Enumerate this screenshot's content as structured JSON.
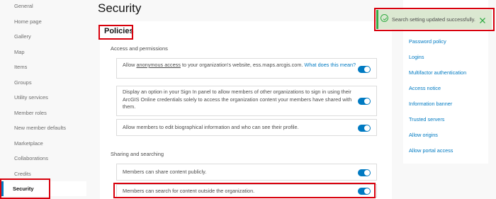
{
  "sidebar": {
    "items": [
      "General",
      "Home page",
      "Gallery",
      "Map",
      "Items",
      "Groups",
      "Utility services",
      "Member roles",
      "New member defaults",
      "Marketplace",
      "Collaborations",
      "Credits"
    ],
    "active": "Security"
  },
  "page": {
    "title": "Security"
  },
  "policies": {
    "title": "Policies",
    "access_section": "Access and permissions",
    "row1": {
      "pre": "Allow ",
      "link_underlined": "anonymous access",
      "mid": " to your organization's website, ess.maps.arcgis.com. ",
      "link": "What does this mean?",
      "on": true
    },
    "row2": {
      "text": "Display an option in your Sign In panel to allow members of other organizations to sign in using their ArcGIS Online credentials solely to access the organization content your members have shared with them.",
      "on": true
    },
    "row3": {
      "text": "Allow members to edit biographical information and who can see their profile.",
      "on": true
    },
    "sharing_section": "Sharing and searching",
    "row4": {
      "text": "Members can share content publicly.",
      "on": true
    },
    "row5": {
      "text": "Members can search for content outside the organization.",
      "on": true
    }
  },
  "right_nav": {
    "items": [
      "Password policy",
      "Logins",
      "Multifactor authentication",
      "Access notice",
      "Information banner",
      "Trusted servers",
      "Allow origins",
      "Allow portal access"
    ]
  },
  "toast": {
    "message": "Search setting updated successfully.",
    "icon": "check-circle-icon",
    "close_icon": "close-icon"
  },
  "colors": {
    "accent": "#007ac2",
    "highlight": "#d8000c",
    "success": "#35ac46",
    "toast_bg": "#dbe8d1"
  }
}
